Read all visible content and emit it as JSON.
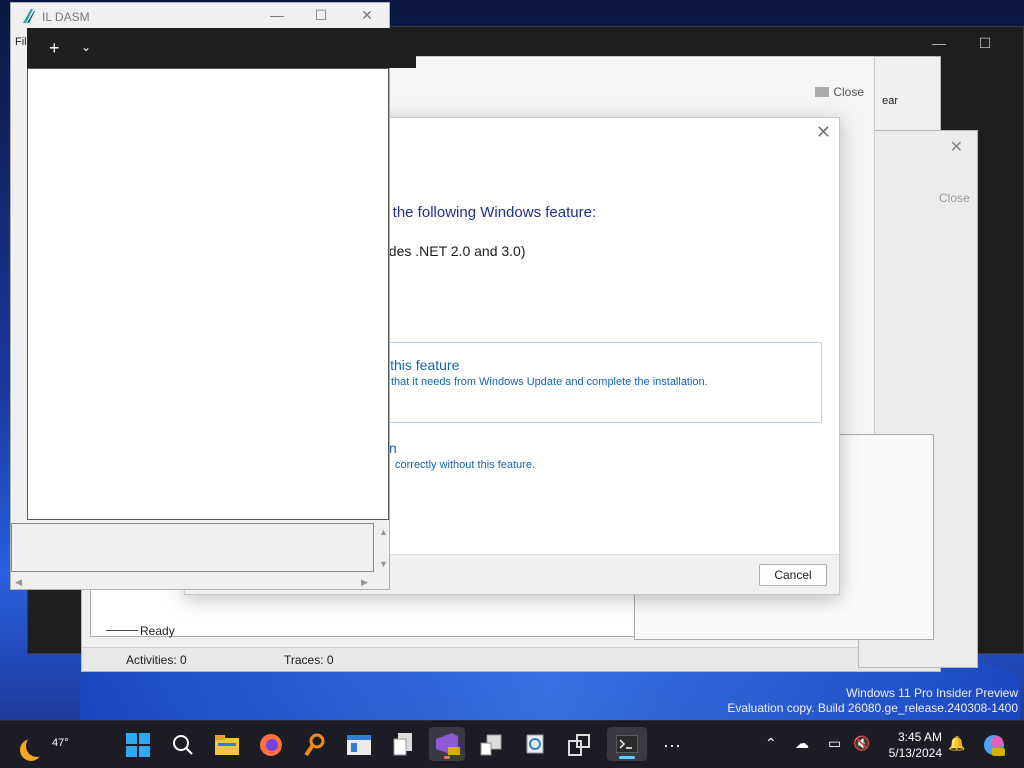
{
  "watermark": {
    "line1": "Windows 11 Pro Insider Preview",
    "line2": "Evaluation copy. Build 26080.ge_release.240308-1400"
  },
  "ildasm": {
    "title": "IL DASM",
    "menu_partial": "Fil"
  },
  "terminal": {
    "new_tab": "+",
    "dropdown": "⌄"
  },
  "trace_window": {
    "close_label": "Close",
    "clear_label": "ear",
    "status_ready": "Ready",
    "activities": "Activities: 0",
    "traces": "Traces: 0",
    "right_close_label": "Close"
  },
  "feature_dialog": {
    "heading": "s the following Windows feature:",
    "feature_name": "ades .NET 2.0 and 3.0)",
    "option1_title": "ll this feature",
    "option1_desc": "that it needs from Windows Update and complete the installation.",
    "option2_title": "n",
    "option2_desc": "correctly without this feature.",
    "cancel": "Cancel"
  },
  "taskbar": {
    "weather_temp": "47°",
    "time": "3:45 AM",
    "date": "5/13/2024",
    "more": "···"
  }
}
